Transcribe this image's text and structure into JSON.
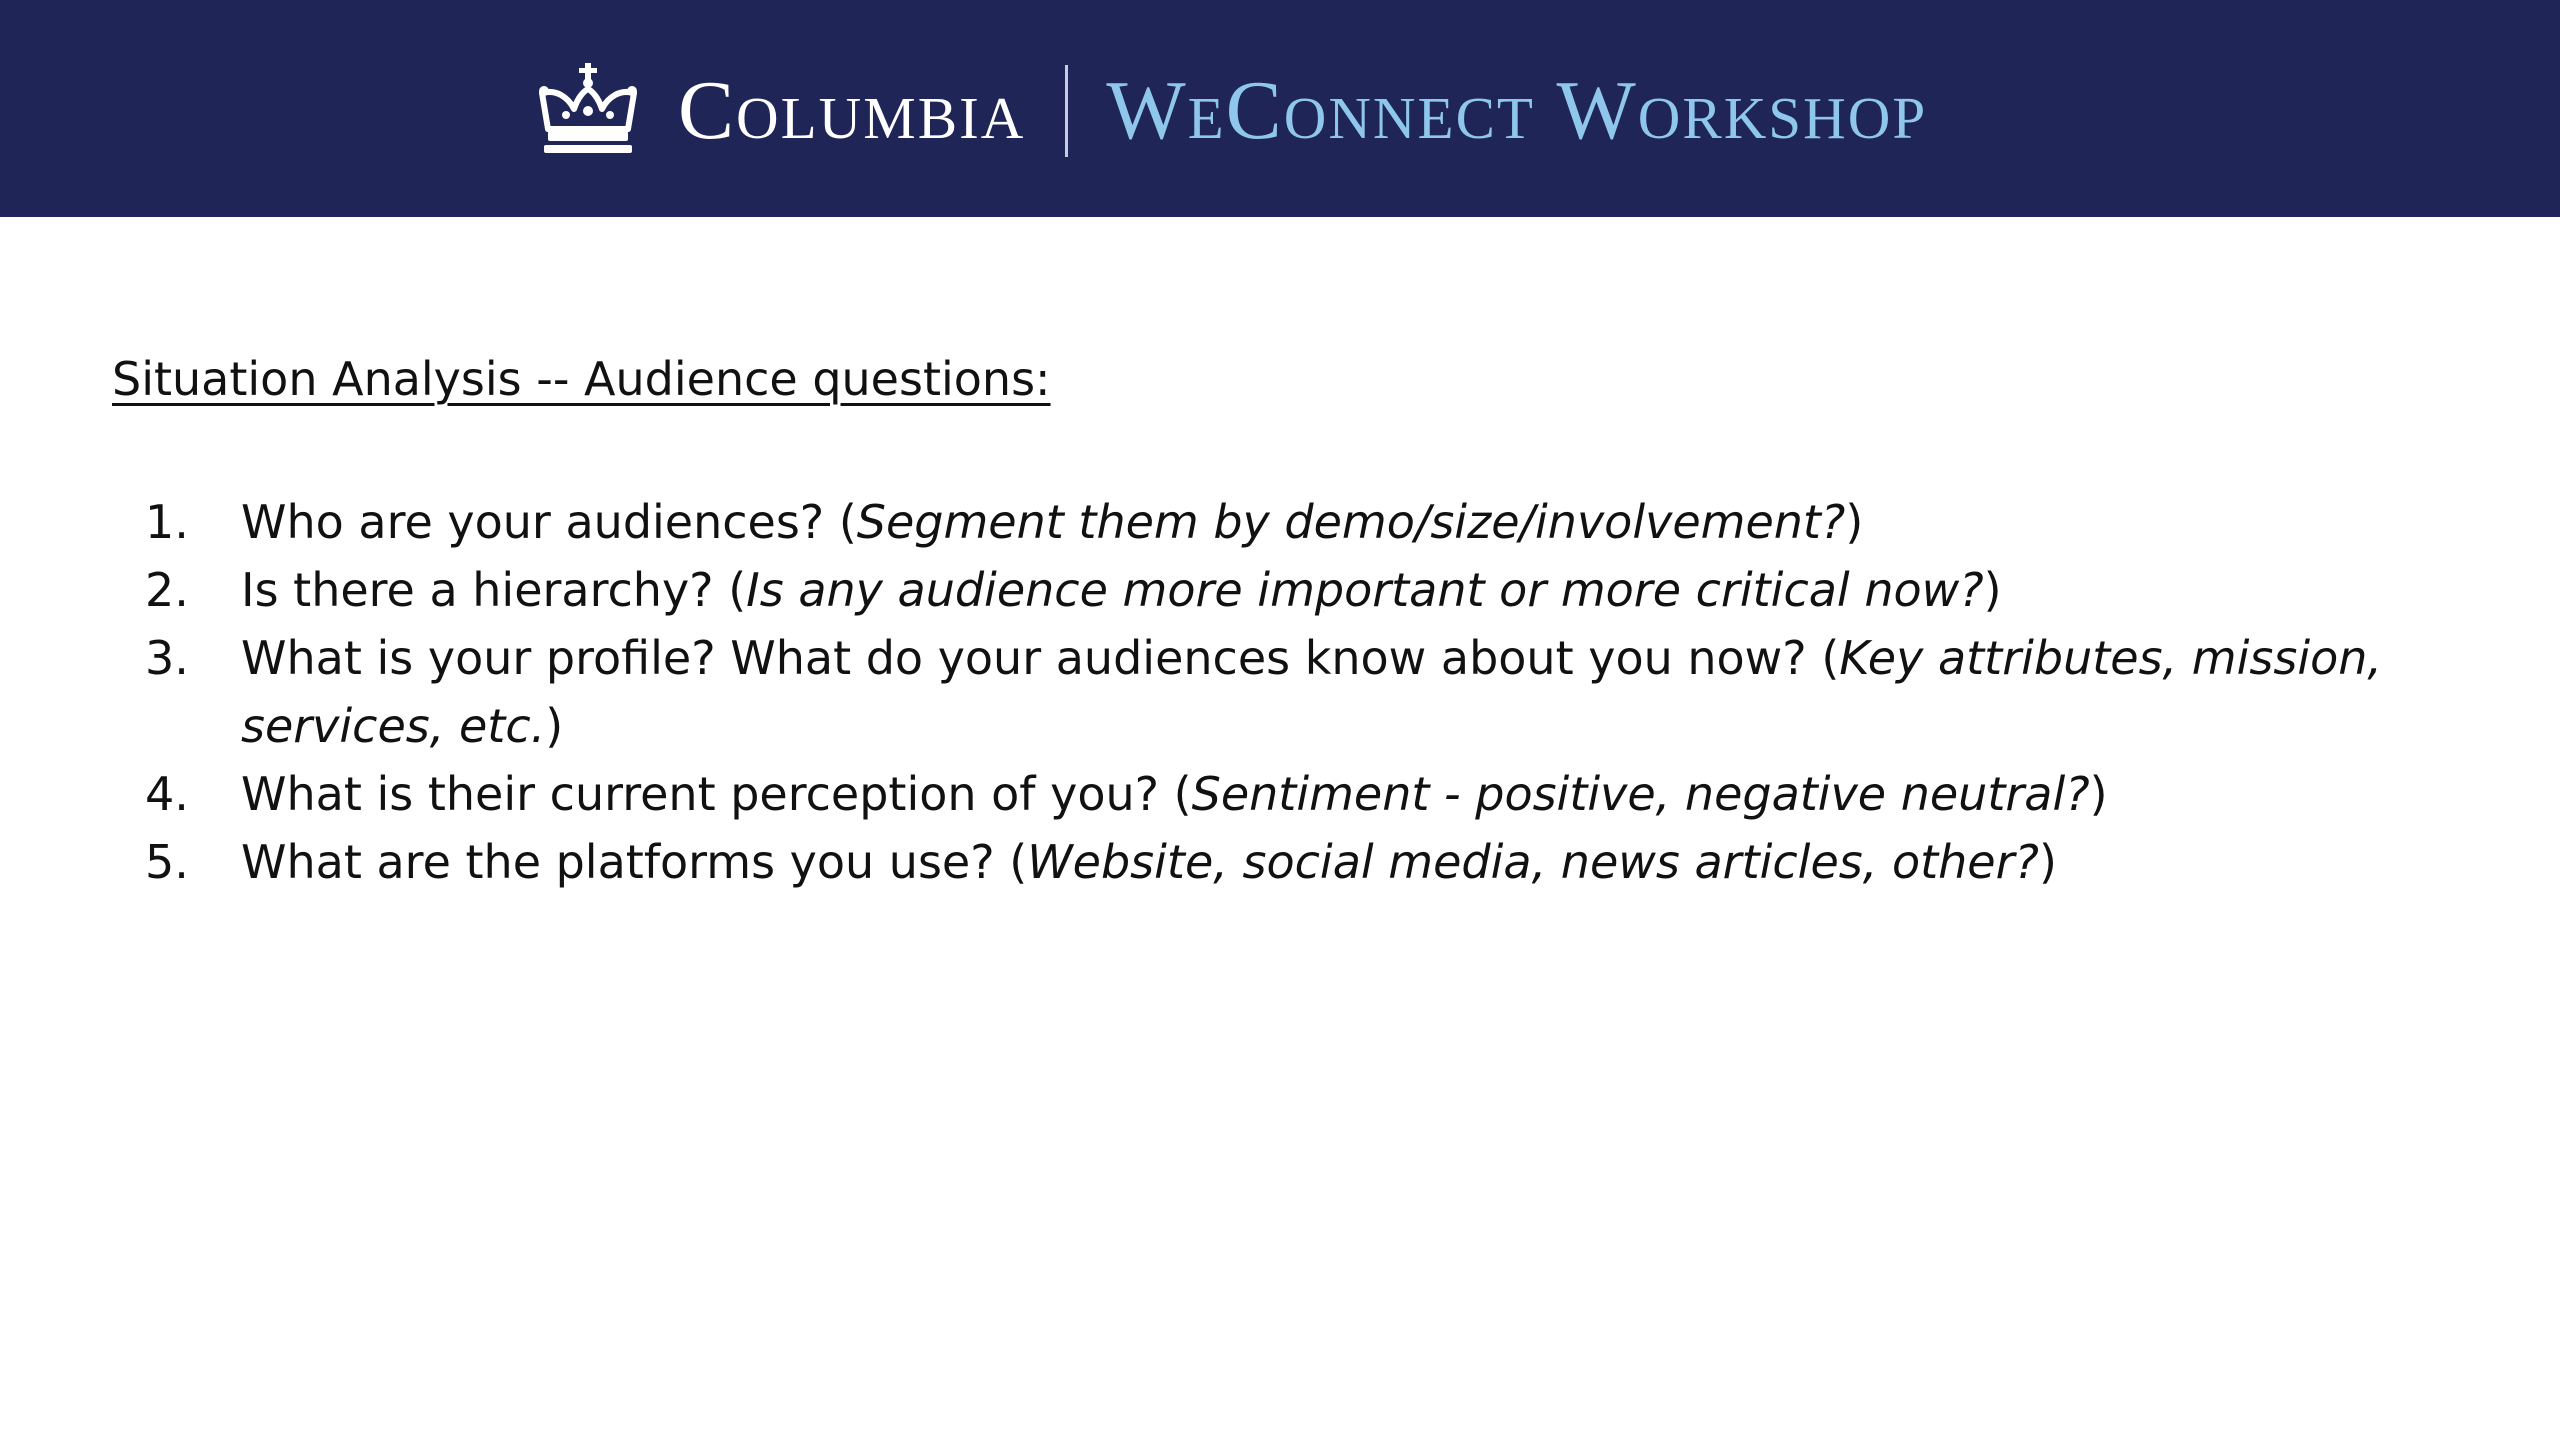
{
  "header": {
    "brand_name": "Columbia",
    "workshop_name": "WeConnect Workshop",
    "logo_icon": "crown-icon",
    "colors": {
      "banner": "#1f2557",
      "brand_text": "#ffffff",
      "workshop_text": "#8ec6ec"
    }
  },
  "content": {
    "heading": "Situation Analysis -- Audience questions:",
    "questions": [
      {
        "number": "1.",
        "text": "Who are your audiences? (",
        "hint": "Segment them by demo/size/involvement?",
        "close": ")"
      },
      {
        "number": "2.",
        "text": "Is there a hierarchy? (",
        "hint": "Is any audience more important or more critical now?",
        "close": ")"
      },
      {
        "number": "3.",
        "text": "What is your profile? What do your audiences know about you now? (",
        "hint": "Key attributes, mission, services, etc.",
        "close": ")"
      },
      {
        "number": "4.",
        "text": "What is their current perception of you? (",
        "hint": "Sentiment - positive, negative neutral?",
        "close": ")"
      },
      {
        "number": "5.",
        "text": "What are the platforms you use? (",
        "hint": "Website, social media, news articles, other?",
        "close": ")"
      }
    ]
  }
}
